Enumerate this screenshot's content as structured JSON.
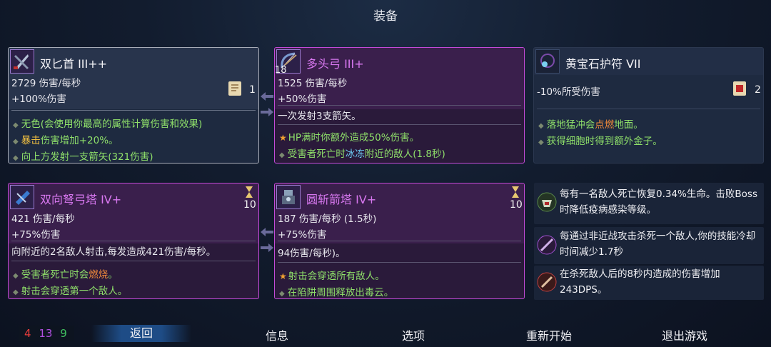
{
  "title": "装备",
  "cards": {
    "dual_daggers": {
      "name": "双匕首  III++",
      "stat1": "2729 伤害/每秒",
      "stat2": "+100%伤害",
      "scroll_count": "1",
      "b1": "无色(会使用你最高的属性计算伤害和效果)",
      "b2_hl": "暴击",
      "b2_rest": "伤害增加+20%。",
      "b3": "向上方发射一支箭矢(321伤害)"
    },
    "multi_bow": {
      "name": "多头弓  III+",
      "badge": "18",
      "stat1": "1525 伤害/每秒",
      "stat2": "+50%伤害",
      "desc": "一次发射3支箭矢。",
      "b1": "HP满时你额外造成50%伤害。",
      "b2_a": "受害者死亡时",
      "b2_hl": "冰冻",
      "b2_b": "附近的敌人(1.8秒)"
    },
    "amulet": {
      "name": "黄宝石护符  VII",
      "stat1": "-10%所受伤害",
      "scroll_count": "2",
      "b1_a": "落地猛冲会",
      "b1_hl": "点燃",
      "b1_b": "地面。",
      "b2": "获得细胞时得到额外金子。"
    },
    "crossbow_turret": {
      "name": "双向弩弓塔  IV+",
      "timer": "10",
      "stat1": "421 伤害/每秒",
      "stat2": "+75%伤害",
      "desc": "向附近的2名敌人射击,每发造成421伤害/每秒。",
      "b1_a": "受害者死亡时会",
      "b1_hl": "燃烧",
      "b1_b": "。",
      "b2": "射击会穿透第一个敌人。"
    },
    "sweeper_turret": {
      "name": "圆斩箭塔  IV+",
      "timer": "10",
      "stat1": "187 伤害/每秒  (1.5秒)",
      "stat2": "+75%伤害",
      "desc": "94伤害/每秒)。",
      "b1": "射击会穿透所有敌人。",
      "b2_a": "在陷阱周围释放出",
      "b2_hl": "毒云",
      "b2_b": "。"
    }
  },
  "mutations": [
    {
      "text": "每有一名敌人死亡恢复0.34%生命。击败Boss时降低疫病感染等级。",
      "icon": "heal-mutation-icon"
    },
    {
      "text": "每通过非近战攻击杀死一个敌人,你的技能冷却时间减少1.7秒",
      "icon": "cooldown-mutation-icon"
    },
    {
      "text": "在杀死敌人后的8秒内造成的伤害增加243DPS。",
      "icon": "damage-mutation-icon"
    }
  ],
  "scrolls": {
    "brutality": "4",
    "tactics": "13",
    "survival": "9"
  },
  "menu": {
    "back": "返回",
    "info": "信息",
    "options": "选项",
    "restart": "重新开始",
    "quit": "退出游戏"
  },
  "colors": {
    "brutality": "#e83c3c",
    "tactics": "#b050e0",
    "survival": "#40c060",
    "purple_border": "#c44ad8"
  }
}
